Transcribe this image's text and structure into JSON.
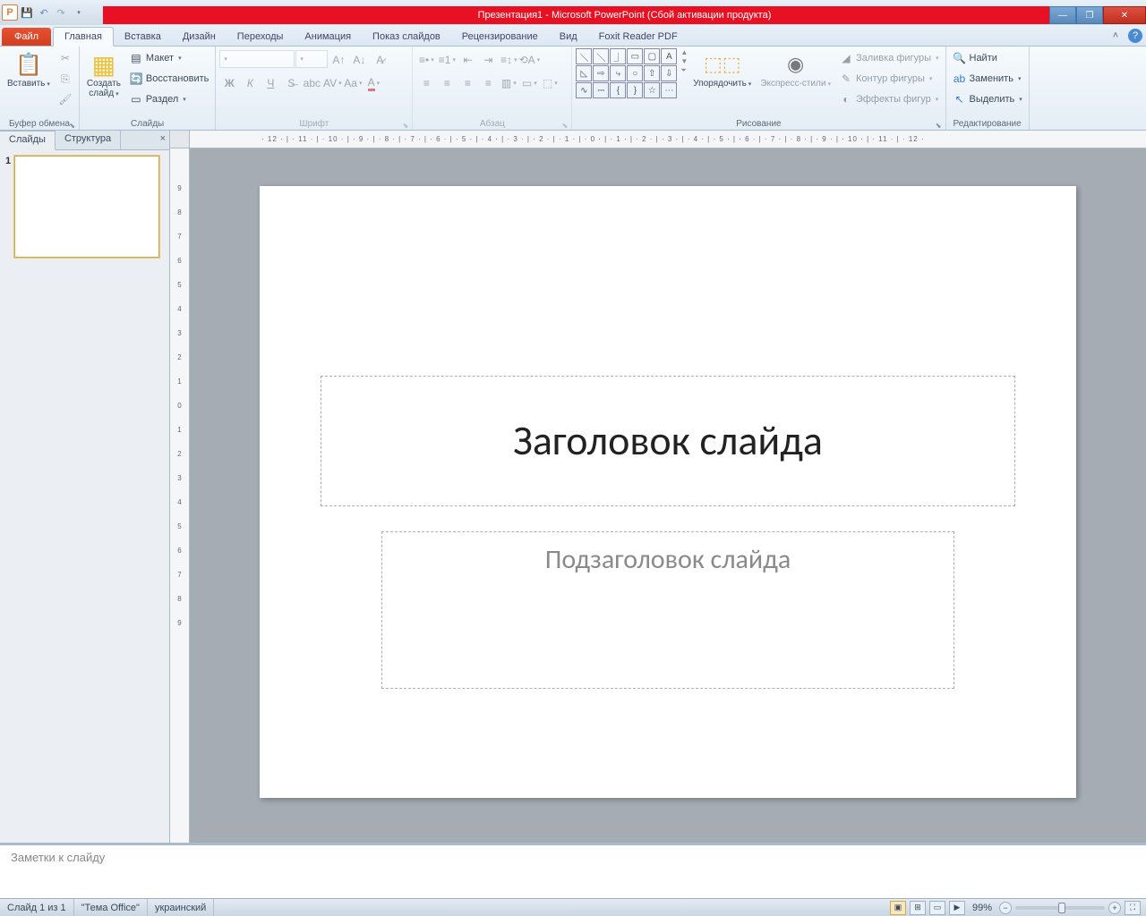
{
  "title": "Презентация1  -  Microsoft PowerPoint (Сбой активации продукта)",
  "tabs": {
    "file": "Файл",
    "home": "Главная",
    "insert": "Вставка",
    "design": "Дизайн",
    "transitions": "Переходы",
    "animations": "Анимация",
    "slideshow": "Показ слайдов",
    "review": "Рецензирование",
    "view": "Вид",
    "foxit": "Foxit Reader PDF"
  },
  "ribbon": {
    "clipboard": {
      "label": "Буфер обмена",
      "paste": "Вставить"
    },
    "slides": {
      "label": "Слайды",
      "new": "Создать\nслайд",
      "layout": "Макет",
      "reset": "Восстановить",
      "section": "Раздел"
    },
    "font": {
      "label": "Шрифт"
    },
    "paragraph": {
      "label": "Абзац"
    },
    "drawing": {
      "label": "Рисование",
      "arrange": "Упорядочить",
      "quickstyles": "Экспресс-стили",
      "fill": "Заливка фигуры",
      "outline": "Контур фигуры",
      "effects": "Эффекты фигур"
    },
    "editing": {
      "label": "Редактирование",
      "find": "Найти",
      "replace": "Заменить",
      "select": "Выделить"
    }
  },
  "panel": {
    "tab_slides": "Слайды",
    "tab_outline": "Структура",
    "thumb_num": "1"
  },
  "hruler": "· 12 · | · 11 · | · 10 · | · 9 · | · 8 · | · 7 · | · 6 · | · 5 · | · 4 · | · 3 · | · 2 · | · 1 · | · 0 · | · 1 · | · 2 · | · 3 · | · 4 · | · 5 · | · 6 · | · 7 · | · 8 · | · 9 · | · 10 · | · 11 · | · 12 ·",
  "vruler": [
    "9",
    "8",
    "7",
    "6",
    "5",
    "4",
    "3",
    "2",
    "1",
    "0",
    "1",
    "2",
    "3",
    "4",
    "5",
    "6",
    "7",
    "8",
    "9"
  ],
  "slide": {
    "title_placeholder": "Заголовок слайда",
    "subtitle_placeholder": "Подзаголовок слайда"
  },
  "notes": {
    "placeholder": "Заметки к слайду"
  },
  "status": {
    "slide": "Слайд 1 из 1",
    "theme": "\"Тема Office\"",
    "lang": "украинский",
    "zoom": "99%"
  }
}
